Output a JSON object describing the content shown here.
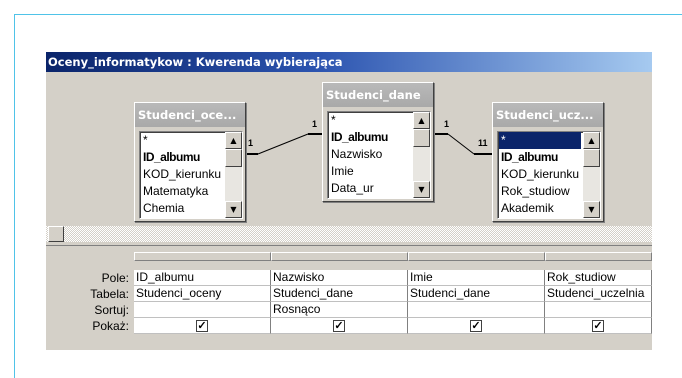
{
  "window": {
    "title": "Oceny_informatykow : Kwerenda wybierająca"
  },
  "tables": [
    {
      "title": "Studenci_oce...",
      "fields": [
        {
          "label": "*",
          "key": false,
          "selected": false
        },
        {
          "label": "ID_albumu",
          "key": true,
          "selected": false
        },
        {
          "label": "KOD_kierunku",
          "key": false,
          "selected": false
        },
        {
          "label": "Matematyka",
          "key": false,
          "selected": false
        },
        {
          "label": "Chemia",
          "key": false,
          "selected": false
        }
      ]
    },
    {
      "title": "Studenci_dane",
      "fields": [
        {
          "label": "*",
          "key": false,
          "selected": false
        },
        {
          "label": "ID_albumu",
          "key": true,
          "selected": false
        },
        {
          "label": "Nazwisko",
          "key": false,
          "selected": false
        },
        {
          "label": "Imie",
          "key": false,
          "selected": false
        },
        {
          "label": "Data_ur",
          "key": false,
          "selected": false
        }
      ]
    },
    {
      "title": "Studenci_ucz...",
      "fields": [
        {
          "label": "*",
          "key": false,
          "selected": true
        },
        {
          "label": "ID_albumu",
          "key": true,
          "selected": false
        },
        {
          "label": "KOD_kierunku",
          "key": false,
          "selected": false
        },
        {
          "label": "Rok_studiow",
          "key": false,
          "selected": false
        },
        {
          "label": "Akademik",
          "key": false,
          "selected": false
        }
      ]
    }
  ],
  "joins": [
    {
      "left_label": "1",
      "right_label": "1"
    },
    {
      "left_label": "1",
      "right_label": "11"
    }
  ],
  "grid": {
    "row_labels": {
      "field": "Pole:",
      "table": "Tabela:",
      "sort": "Sortuj:",
      "show": "Pokaż:"
    },
    "columns": [
      {
        "field": "ID_albumu",
        "table": "Studenci_oceny",
        "sort": "",
        "show": true
      },
      {
        "field": "Nazwisko",
        "table": "Studenci_dane",
        "sort": "Rosnąco",
        "show": true
      },
      {
        "field": "Imie",
        "table": "Studenci_dane",
        "sort": "",
        "show": true
      },
      {
        "field": "Rok_studiow",
        "table": "Studenci_uczelnia",
        "sort": "",
        "show": true
      }
    ]
  },
  "colors": {
    "title_bar_start": "#0a246a",
    "title_bar_end": "#a6caf0",
    "frame_accent": "#4fc3e8",
    "selection": "#0a246a"
  }
}
